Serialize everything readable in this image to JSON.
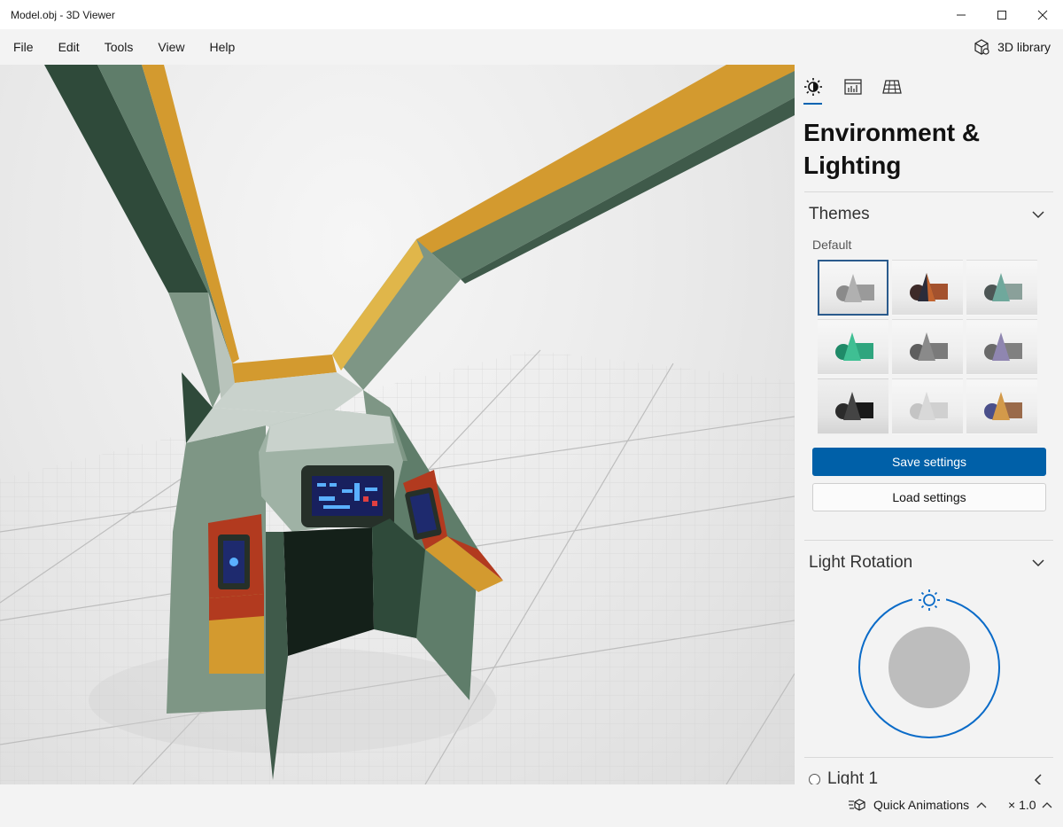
{
  "window": {
    "title": "Model.obj - 3D Viewer",
    "controls": [
      "minimize-icon",
      "maximize-icon",
      "close-icon"
    ]
  },
  "menu": {
    "items": [
      "File",
      "Edit",
      "Tools",
      "View",
      "Help"
    ],
    "library_label": "3D library"
  },
  "panel": {
    "tabs": [
      "sun-icon",
      "stats-icon",
      "grid-icon"
    ],
    "active_tab": 0,
    "title": "Environment & Lighting",
    "themes": {
      "header": "Themes",
      "default_label": "Default",
      "selected_index": 0,
      "save_label": "Save settings",
      "load_label": "Load settings"
    },
    "light_rotation": {
      "header": "Light Rotation"
    },
    "light1": {
      "label": "Light 1"
    }
  },
  "status": {
    "quick_animations_label": "Quick Animations",
    "speed_label": "× 1.0"
  },
  "colors": {
    "accent": "#0063b1",
    "save_button": "#0060a8",
    "hull_green": "#5f7d6a",
    "hull_orange": "#d39a2f",
    "panel_red": "#b23a1f"
  }
}
